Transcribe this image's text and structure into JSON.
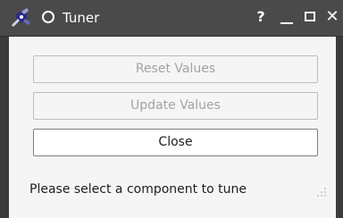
{
  "window": {
    "title": "Tuner",
    "controls": {
      "help": "?",
      "close": "✕"
    }
  },
  "buttons": {
    "reset_label": "Reset Values",
    "update_label": "Update Values",
    "close_label": "Close"
  },
  "status": {
    "text": "Please select a component to tune"
  },
  "icons": {
    "app": "app-logo-icon",
    "pin": "pin-icon",
    "minimize": "minimize-icon",
    "maximize": "maximize-icon",
    "close": "close-icon",
    "resize": "resize-grip-icon"
  },
  "colors": {
    "titlebar": "#4a4a4a",
    "content_bg": "#f5f5f5",
    "disabled_text": "#a3a3a3",
    "text": "#1e1e1e"
  }
}
